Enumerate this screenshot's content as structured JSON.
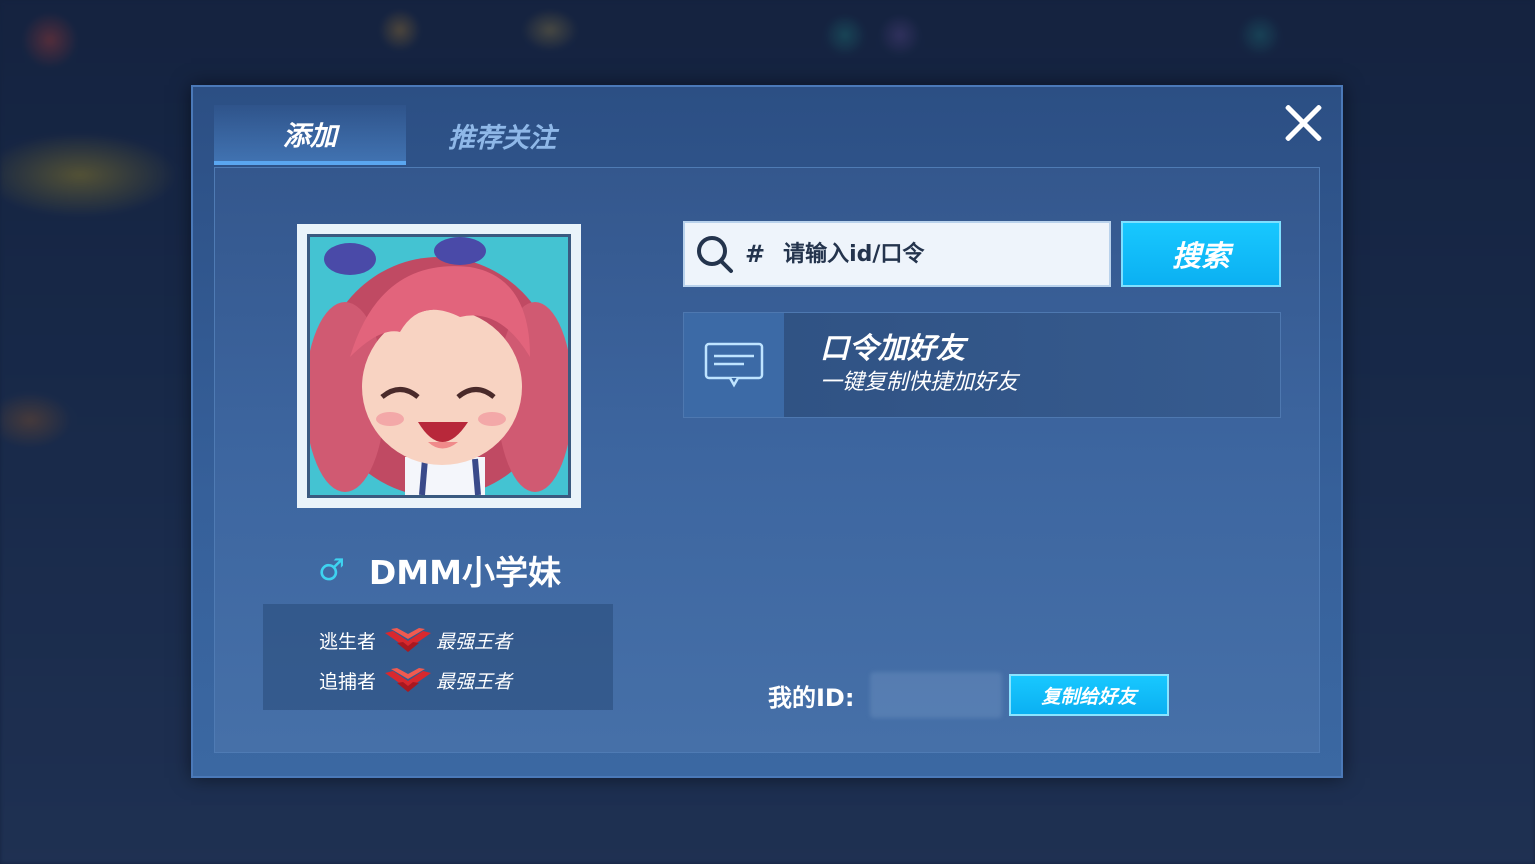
{
  "tabs": [
    {
      "label": "添加",
      "active": true
    },
    {
      "label": "推荐关注",
      "active": false
    }
  ],
  "profile": {
    "gender_symbol": "♂",
    "name": "DMM小学妹",
    "ranks": [
      {
        "role": "逃生者",
        "title": "最强王者"
      },
      {
        "role": "追捕者",
        "title": "最强王者"
      }
    ]
  },
  "search": {
    "hash": "#",
    "placeholder": "请输入id/口令",
    "button_label": "搜索"
  },
  "code_card": {
    "title": "口令加好友",
    "subtitle": "一键复制快捷加好友"
  },
  "my_id": {
    "label": "我的ID:",
    "copy_button_label": "复制给好友"
  },
  "colors": {
    "accent": "#12bff8",
    "gender": "#3ed3f0",
    "panel": "#3a619a"
  }
}
